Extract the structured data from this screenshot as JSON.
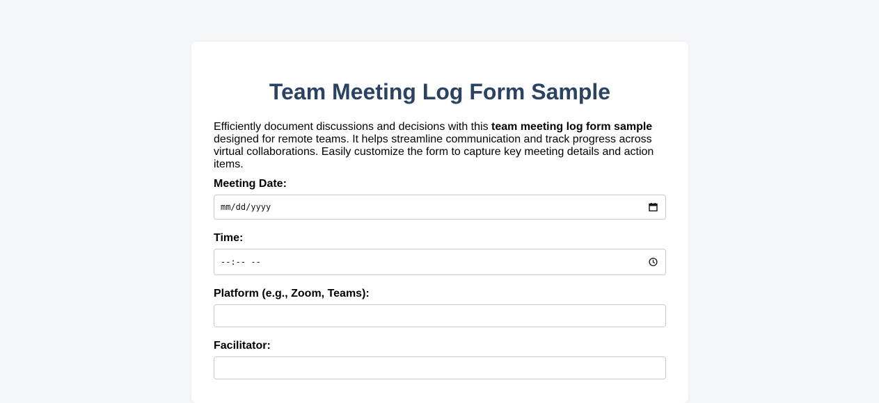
{
  "form": {
    "title": "Team Meeting Log Form Sample",
    "intro_before": "Efficiently document discussions and decisions with this ",
    "intro_bold": "team meeting log form sample",
    "intro_after": " designed for remote teams. It helps streamline communication and track progress across virtual collaborations. Easily customize the form to capture key meeting details and action items.",
    "fields": {
      "date": {
        "label": "Meeting Date:",
        "placeholder": "mm/dd/yyyy",
        "icon": "calendar-icon"
      },
      "time": {
        "label": "Time:",
        "placeholder": "--:-- --",
        "icon": "clock-icon"
      },
      "platform": {
        "label": "Platform (e.g., Zoom, Teams):",
        "value": ""
      },
      "facilitator": {
        "label": "Facilitator:",
        "value": ""
      }
    }
  },
  "colors": {
    "page_background": "#f6f7f9",
    "card_background": "#ffffff",
    "title": "#2a4263",
    "input_border": "#c9c9c9"
  }
}
